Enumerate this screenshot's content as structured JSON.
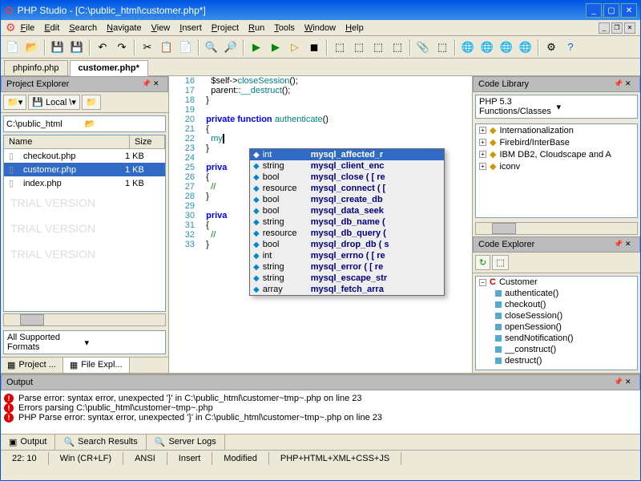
{
  "title": "PHP Studio - [C:\\public_html\\customer.php*]",
  "menu": [
    "File",
    "Edit",
    "Search",
    "Navigate",
    "View",
    "Insert",
    "Project",
    "Run",
    "Tools",
    "Window",
    "Help"
  ],
  "tabs": [
    {
      "label": "phpinfo.php",
      "active": false
    },
    {
      "label": "customer.php*",
      "active": true
    }
  ],
  "projectExplorer": {
    "title": "Project Explorer",
    "drive": "Local \\",
    "path": "C:\\public_html",
    "cols": {
      "name": "Name",
      "size": "Size"
    },
    "files": [
      {
        "name": "checkout.php",
        "size": "1 KB"
      },
      {
        "name": "customer.php",
        "size": "1 KB"
      },
      {
        "name": "index.php",
        "size": "1 KB"
      }
    ],
    "format": "All Supported Formats",
    "paneTabs": [
      "Project ...",
      "File Expl..."
    ]
  },
  "editor": {
    "lines": [
      {
        "n": 16,
        "pre": "    ",
        "tokens": [
          {
            "t": "$self->",
            "c": ""
          },
          {
            "t": "closeSession",
            "c": "fn"
          },
          {
            "t": "();",
            "c": ""
          }
        ]
      },
      {
        "n": 17,
        "pre": "    ",
        "tokens": [
          {
            "t": "parent::",
            "c": ""
          },
          {
            "t": "__destruct",
            "c": "fn"
          },
          {
            "t": "();",
            "c": ""
          }
        ]
      },
      {
        "n": 18,
        "pre": "  ",
        "tokens": [
          {
            "t": "}",
            "c": ""
          }
        ]
      },
      {
        "n": 19,
        "pre": "",
        "tokens": []
      },
      {
        "n": 20,
        "pre": "  ",
        "tokens": [
          {
            "t": "private function ",
            "c": "kw"
          },
          {
            "t": "authenticate",
            "c": "fn"
          },
          {
            "t": "()",
            "c": ""
          }
        ]
      },
      {
        "n": 21,
        "pre": "  ",
        "tokens": [
          {
            "t": "{",
            "c": ""
          }
        ]
      },
      {
        "n": 22,
        "pre": "    ",
        "tokens": [
          {
            "t": "my",
            "c": "fn",
            "cursor": true
          }
        ]
      },
      {
        "n": 23,
        "pre": "  ",
        "tokens": [
          {
            "t": "}",
            "c": ""
          }
        ]
      },
      {
        "n": 24,
        "pre": "",
        "tokens": []
      },
      {
        "n": 25,
        "pre": "  ",
        "tokens": [
          {
            "t": "priva",
            "c": "kw"
          }
        ]
      },
      {
        "n": 26,
        "pre": "  ",
        "tokens": [
          {
            "t": "{",
            "c": ""
          }
        ]
      },
      {
        "n": 27,
        "pre": "    ",
        "tokens": [
          {
            "t": "//",
            "c": "cm"
          }
        ]
      },
      {
        "n": 28,
        "pre": "  ",
        "tokens": [
          {
            "t": "}",
            "c": ""
          }
        ]
      },
      {
        "n": 29,
        "pre": "",
        "tokens": []
      },
      {
        "n": 30,
        "pre": "  ",
        "tokens": [
          {
            "t": "priva",
            "c": "kw"
          }
        ]
      },
      {
        "n": 31,
        "pre": "  ",
        "tokens": [
          {
            "t": "{",
            "c": ""
          }
        ]
      },
      {
        "n": 32,
        "pre": "    ",
        "tokens": [
          {
            "t": "//",
            "c": "cm"
          }
        ]
      },
      {
        "n": 33,
        "pre": "  ",
        "tokens": [
          {
            "t": "}",
            "c": ""
          }
        ]
      }
    ],
    "popup": [
      {
        "type": "int",
        "fn": "mysql_affected_r",
        "sel": true
      },
      {
        "type": "string",
        "fn": "mysql_client_enc"
      },
      {
        "type": "bool",
        "fn": "mysql_close ( [ re"
      },
      {
        "type": "resource",
        "fn": "mysql_connect ( ["
      },
      {
        "type": "bool",
        "fn": "mysql_create_db"
      },
      {
        "type": "bool",
        "fn": "mysql_data_seek"
      },
      {
        "type": "string",
        "fn": "mysql_db_name ("
      },
      {
        "type": "resource",
        "fn": "mysql_db_query ("
      },
      {
        "type": "bool",
        "fn": "mysql_drop_db ( s"
      },
      {
        "type": "int",
        "fn": "mysql_errno ( [ re"
      },
      {
        "type": "string",
        "fn": "mysql_error ( [ re"
      },
      {
        "type": "string",
        "fn": "mysql_escape_str"
      },
      {
        "type": "array",
        "fn": "mysql_fetch_arra"
      }
    ]
  },
  "codeLibrary": {
    "title": "Code Library",
    "select": "PHP 5.3 Functions/Classes",
    "items": [
      "Internationalization",
      "Firebird/InterBase",
      "IBM DB2, Cloudscape and A",
      "iconv"
    ]
  },
  "codeExplorer": {
    "title": "Code Explorer",
    "class": "Customer",
    "methods": [
      "authenticate()",
      "checkout()",
      "closeSession()",
      "openSession()",
      "sendNotification()",
      "__construct()",
      "destruct()"
    ]
  },
  "output": {
    "title": "Output",
    "lines": [
      "Parse error: syntax error, unexpected '}' in C:\\public_html\\customer~tmp~.php on line 23",
      "Errors parsing C:\\public_html\\customer~tmp~.php",
      "PHP Parse error:  syntax error, unexpected '}' in C:\\public_html\\customer~tmp~.php on line 23"
    ],
    "tabs": [
      "Output",
      "Search Results",
      "Server Logs"
    ]
  },
  "status": {
    "pos": "22: 10",
    "eol": "Win (CR+LF)",
    "enc": "ANSI",
    "mode": "Insert",
    "mod": "Modified",
    "lang": "PHP+HTML+XML+CSS+JS"
  }
}
